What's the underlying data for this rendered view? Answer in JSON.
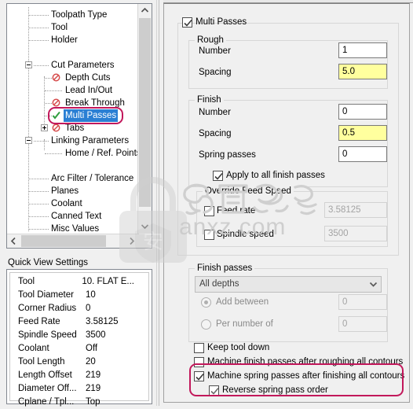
{
  "tree": {
    "items": [
      {
        "label": "Toolpath Type",
        "icon": "none",
        "state": "normal"
      },
      {
        "label": "Tool",
        "icon": "none",
        "state": "normal"
      },
      {
        "label": "Holder",
        "icon": "none",
        "state": "normal"
      },
      {
        "label": "Cut Parameters",
        "icon": "none",
        "state": "normal"
      },
      {
        "label": "Depth Cuts",
        "icon": "disabled-icon",
        "state": "normal"
      },
      {
        "label": "Lead In/Out",
        "icon": "none",
        "state": "normal"
      },
      {
        "label": "Break Through",
        "icon": "disabled-icon",
        "state": "normal"
      },
      {
        "label": "Multi Passes",
        "icon": "check-icon",
        "state": "selected"
      },
      {
        "label": "Tabs",
        "icon": "disabled-icon",
        "state": "normal"
      },
      {
        "label": "Linking Parameters",
        "icon": "none",
        "state": "normal"
      },
      {
        "label": "Home / Ref. Points",
        "icon": "none",
        "state": "normal"
      },
      {
        "label": "Arc Filter / Tolerance",
        "icon": "none",
        "state": "normal"
      },
      {
        "label": "Planes",
        "icon": "none",
        "state": "normal"
      },
      {
        "label": "Coolant",
        "icon": "none",
        "state": "normal"
      },
      {
        "label": "Canned Text",
        "icon": "none",
        "state": "normal"
      },
      {
        "label": "Misc Values",
        "icon": "none",
        "state": "normal"
      }
    ],
    "selection_highlight_color": "#2a7fd4",
    "annotation_color": "#c2185b"
  },
  "quick_view": {
    "title": "Quick View Settings",
    "rows": [
      {
        "key": "Tool",
        "value": "10. FLAT E..."
      },
      {
        "key": "Tool Diameter",
        "value": "10"
      },
      {
        "key": "Corner Radius",
        "value": "0"
      },
      {
        "key": "Feed Rate",
        "value": "3.58125"
      },
      {
        "key": "Spindle Speed",
        "value": "3500"
      },
      {
        "key": "Coolant",
        "value": "Off"
      },
      {
        "key": "Tool Length",
        "value": "20"
      },
      {
        "key": "Length Offset",
        "value": "219"
      },
      {
        "key": "Diameter Off...",
        "value": "219"
      },
      {
        "key": "Cplane / Tpl...",
        "value": "Top"
      }
    ]
  },
  "panel": {
    "multi_passes": {
      "label": "Multi Passes",
      "checked": true
    },
    "rough": {
      "title": "Rough",
      "number_label": "Number",
      "number_value": "1",
      "spacing_label": "Spacing",
      "spacing_value": "5.0",
      "spacing_highlight": "#ffff9e"
    },
    "finish": {
      "title": "Finish",
      "number_label": "Number",
      "number_value": "0",
      "spacing_label": "Spacing",
      "spacing_value": "0.5",
      "spacing_highlight": "#ffff9e",
      "spring_label": "Spring passes",
      "spring_value": "0",
      "apply_all_label": "Apply to all finish passes",
      "apply_all_checked": true
    },
    "override": {
      "title": "Override Feed Speed",
      "feed_rate_label": "Feed rate",
      "feed_rate_value": "3.58125",
      "feed_rate_checked": false,
      "spindle_label": "Spindle speed",
      "spindle_value": "3500",
      "spindle_checked": false
    },
    "finish_passes": {
      "title": "Finish passes",
      "mode_value": "All depths",
      "add_between_label": "Add between",
      "add_between_value": "0",
      "add_between_selected": true,
      "per_number_label": "Per number of",
      "per_number_value": "0",
      "per_number_selected": false
    },
    "options": [
      {
        "label": "Keep tool down",
        "checked": false,
        "highlighted": false
      },
      {
        "label": "Machine finish passes after roughing all contours",
        "checked": false,
        "highlighted": false
      },
      {
        "label": "Machine spring passes after finishing all contours",
        "checked": true,
        "highlighted": true
      },
      {
        "label": "Reverse spring pass order",
        "checked": true,
        "highlighted": true
      }
    ]
  },
  "watermark": {
    "text": "anxz.com"
  }
}
